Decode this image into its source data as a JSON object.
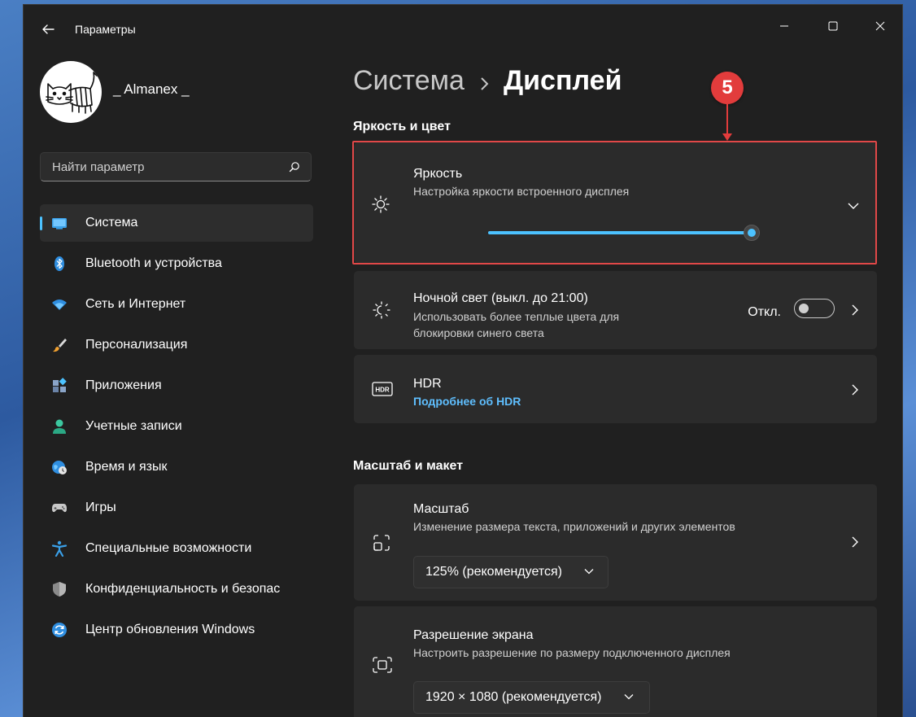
{
  "window": {
    "app_title": "Параметры"
  },
  "profile": {
    "user_name": "_ Almanex _"
  },
  "search": {
    "placeholder": "Найти параметр"
  },
  "sidebar": {
    "items": [
      {
        "label": "Система",
        "icon": "display-icon",
        "active": true
      },
      {
        "label": "Bluetooth и устройства",
        "icon": "bluetooth-icon"
      },
      {
        "label": "Сеть и Интернет",
        "icon": "wifi-icon"
      },
      {
        "label": "Персонализация",
        "icon": "brush-icon"
      },
      {
        "label": "Приложения",
        "icon": "apps-icon"
      },
      {
        "label": "Учетные записи",
        "icon": "person-icon"
      },
      {
        "label": "Время и язык",
        "icon": "globe-clock-icon"
      },
      {
        "label": "Игры",
        "icon": "gamepad-icon"
      },
      {
        "label": "Специальные возможности",
        "icon": "accessibility-icon"
      },
      {
        "label": "Конфиденциальность и безопас",
        "icon": "shield-icon"
      },
      {
        "label": "Центр обновления Windows",
        "icon": "update-icon"
      }
    ]
  },
  "breadcrumb": {
    "parent": "Система",
    "current": "Дисплей"
  },
  "sections": {
    "brightness_color": "Яркость и цвет",
    "scale_layout": "Масштаб и макет"
  },
  "brightness": {
    "title": "Яркость",
    "subtitle": "Настройка яркости встроенного дисплея",
    "level_percent": 100
  },
  "night_light": {
    "title": "Ночной свет (выкл. до 21:00)",
    "subtitle_line1": "Использовать более теплые цвета для",
    "subtitle_line2": "блокировки синего света",
    "toggle_label": "Откл.",
    "toggle_on": false
  },
  "hdr": {
    "title": "HDR",
    "link": "Подробнее об HDR"
  },
  "scale": {
    "title": "Масштаб",
    "subtitle": "Изменение размера текста, приложений и других элементов",
    "value": "125% (рекомендуется)"
  },
  "resolution": {
    "title": "Разрешение экрана",
    "subtitle": "Настроить разрешение по размеру подключенного дисплея",
    "value": "1920 × 1080 (рекомендуется)"
  },
  "annotation": {
    "number": "5"
  },
  "colors": {
    "accent": "#4cc2ff",
    "window_bg": "#202020",
    "card_bg": "#2b2b2b",
    "highlight": "#e14848"
  }
}
